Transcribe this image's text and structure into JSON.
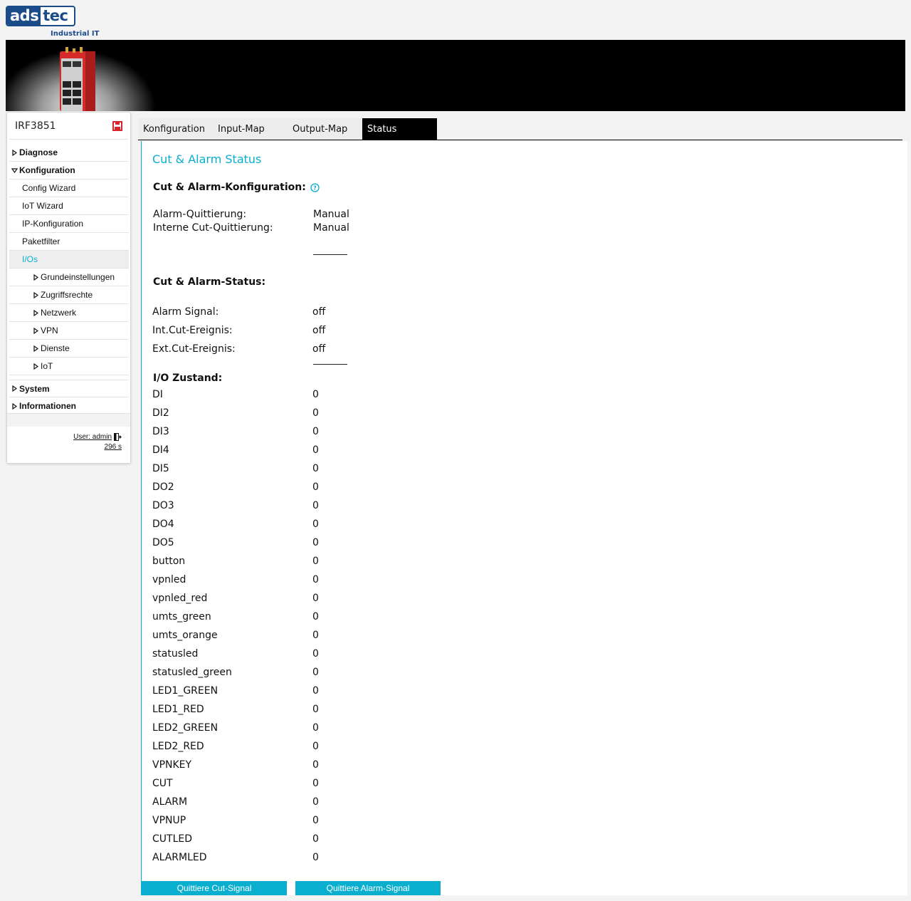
{
  "brand": {
    "logo_left": "ads",
    "logo_right": "tec",
    "tagline": "Industrial IT",
    "accent": "#0aaecf",
    "logo_blue": "#1b4b88"
  },
  "sidebar": {
    "device_name": "IRF3851",
    "save_icon": "floppy-disk-icon",
    "items": [
      {
        "label": "Diagnose",
        "level": 0,
        "expanded": false
      },
      {
        "label": "Konfiguration",
        "level": 0,
        "expanded": true
      },
      {
        "label": "Config Wizard",
        "level": 1
      },
      {
        "label": "IoT Wizard",
        "level": 1
      },
      {
        "label": "IP-Konfiguration",
        "level": 1
      },
      {
        "label": "Paketfilter",
        "level": 1
      },
      {
        "label": "I/Os",
        "level": 1,
        "active": true
      },
      {
        "label": "Grundeinstellungen",
        "level": 2
      },
      {
        "label": "Zugriffsrechte",
        "level": 2
      },
      {
        "label": "Netzwerk",
        "level": 2
      },
      {
        "label": "VPN",
        "level": 2
      },
      {
        "label": "Dienste",
        "level": 2
      },
      {
        "label": "IoT",
        "level": 2
      },
      {
        "label": "System",
        "level": 0,
        "expanded": false
      },
      {
        "label": "Informationen",
        "level": 0,
        "expanded": false
      }
    ],
    "user": "User: admin",
    "timer": "296 s"
  },
  "tabs": [
    {
      "label": "Konfiguration",
      "active": false
    },
    {
      "label": "Input-Map",
      "active": false
    },
    {
      "label": "Output-Map",
      "active": false
    },
    {
      "label": "Status",
      "active": true
    }
  ],
  "content": {
    "title": "Cut & Alarm Status",
    "config_heading": "Cut & Alarm-Konfiguration:",
    "config_rows": [
      {
        "label": "Alarm-Quittierung:",
        "value": "Manual"
      },
      {
        "label": "Interne Cut-Quittierung:",
        "value": "Manual"
      }
    ],
    "status_heading": "Cut & Alarm-Status:",
    "status_rows": [
      {
        "label": "Alarm Signal:",
        "value": "off"
      },
      {
        "label": "Int.Cut-Ereignis:",
        "value": "off"
      },
      {
        "label": "Ext.Cut-Ereignis:",
        "value": "off"
      }
    ],
    "io_heading": "I/O Zustand:",
    "io_rows": [
      {
        "label": "DI",
        "value": "0"
      },
      {
        "label": "DI2",
        "value": "0"
      },
      {
        "label": "DI3",
        "value": "0"
      },
      {
        "label": "DI4",
        "value": "0"
      },
      {
        "label": "DI5",
        "value": "0"
      },
      {
        "label": "DO2",
        "value": "0"
      },
      {
        "label": "DO3",
        "value": "0"
      },
      {
        "label": "DO4",
        "value": "0"
      },
      {
        "label": "DO5",
        "value": "0"
      },
      {
        "label": "button",
        "value": "0"
      },
      {
        "label": "vpnled",
        "value": "0"
      },
      {
        "label": "vpnled_red",
        "value": "0"
      },
      {
        "label": "umts_green",
        "value": "0"
      },
      {
        "label": "umts_orange",
        "value": "0"
      },
      {
        "label": "statusled",
        "value": "0"
      },
      {
        "label": "statusled_green",
        "value": "0"
      },
      {
        "label": "LED1_GREEN",
        "value": "0"
      },
      {
        "label": "LED1_RED",
        "value": "0"
      },
      {
        "label": "LED2_GREEN",
        "value": "0"
      },
      {
        "label": "LED2_RED",
        "value": "0"
      },
      {
        "label": "VPNKEY",
        "value": "0"
      },
      {
        "label": "CUT",
        "value": "0"
      },
      {
        "label": "ALARM",
        "value": "0"
      },
      {
        "label": "VPNUP",
        "value": "0"
      },
      {
        "label": "CUTLED",
        "value": "0"
      },
      {
        "label": "ALARMLED",
        "value": "0"
      }
    ],
    "buttons": {
      "ack_cut": "Quittiere Cut-Signal",
      "ack_alarm": "Quittiere Alarm-Signal"
    }
  }
}
